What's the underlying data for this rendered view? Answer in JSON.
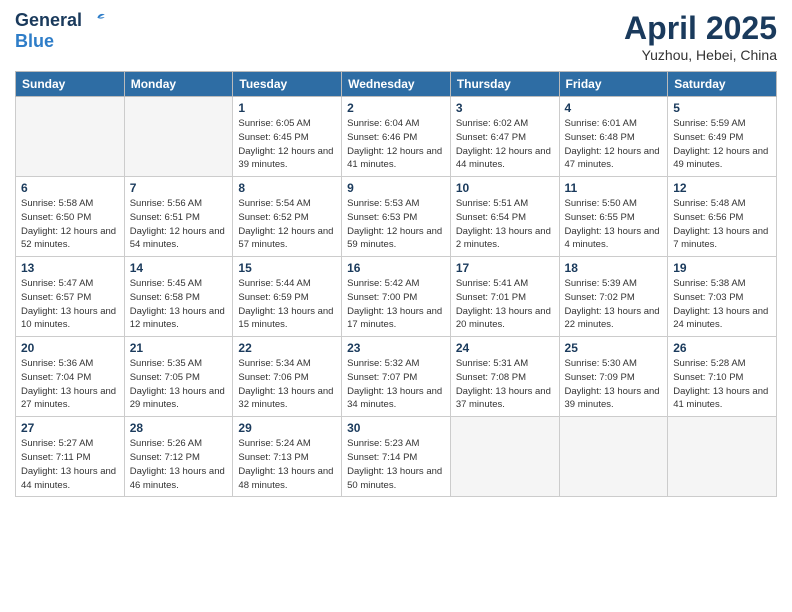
{
  "header": {
    "logo_general": "General",
    "logo_blue": "Blue",
    "month_title": "April 2025",
    "location": "Yuzhou, Hebei, China"
  },
  "weekdays": [
    "Sunday",
    "Monday",
    "Tuesday",
    "Wednesday",
    "Thursday",
    "Friday",
    "Saturday"
  ],
  "weeks": [
    [
      {
        "day": "",
        "empty": true
      },
      {
        "day": "",
        "empty": true
      },
      {
        "day": "1",
        "sunrise": "Sunrise: 6:05 AM",
        "sunset": "Sunset: 6:45 PM",
        "daylight": "Daylight: 12 hours and 39 minutes."
      },
      {
        "day": "2",
        "sunrise": "Sunrise: 6:04 AM",
        "sunset": "Sunset: 6:46 PM",
        "daylight": "Daylight: 12 hours and 41 minutes."
      },
      {
        "day": "3",
        "sunrise": "Sunrise: 6:02 AM",
        "sunset": "Sunset: 6:47 PM",
        "daylight": "Daylight: 12 hours and 44 minutes."
      },
      {
        "day": "4",
        "sunrise": "Sunrise: 6:01 AM",
        "sunset": "Sunset: 6:48 PM",
        "daylight": "Daylight: 12 hours and 47 minutes."
      },
      {
        "day": "5",
        "sunrise": "Sunrise: 5:59 AM",
        "sunset": "Sunset: 6:49 PM",
        "daylight": "Daylight: 12 hours and 49 minutes."
      }
    ],
    [
      {
        "day": "6",
        "sunrise": "Sunrise: 5:58 AM",
        "sunset": "Sunset: 6:50 PM",
        "daylight": "Daylight: 12 hours and 52 minutes."
      },
      {
        "day": "7",
        "sunrise": "Sunrise: 5:56 AM",
        "sunset": "Sunset: 6:51 PM",
        "daylight": "Daylight: 12 hours and 54 minutes."
      },
      {
        "day": "8",
        "sunrise": "Sunrise: 5:54 AM",
        "sunset": "Sunset: 6:52 PM",
        "daylight": "Daylight: 12 hours and 57 minutes."
      },
      {
        "day": "9",
        "sunrise": "Sunrise: 5:53 AM",
        "sunset": "Sunset: 6:53 PM",
        "daylight": "Daylight: 12 hours and 59 minutes."
      },
      {
        "day": "10",
        "sunrise": "Sunrise: 5:51 AM",
        "sunset": "Sunset: 6:54 PM",
        "daylight": "Daylight: 13 hours and 2 minutes."
      },
      {
        "day": "11",
        "sunrise": "Sunrise: 5:50 AM",
        "sunset": "Sunset: 6:55 PM",
        "daylight": "Daylight: 13 hours and 4 minutes."
      },
      {
        "day": "12",
        "sunrise": "Sunrise: 5:48 AM",
        "sunset": "Sunset: 6:56 PM",
        "daylight": "Daylight: 13 hours and 7 minutes."
      }
    ],
    [
      {
        "day": "13",
        "sunrise": "Sunrise: 5:47 AM",
        "sunset": "Sunset: 6:57 PM",
        "daylight": "Daylight: 13 hours and 10 minutes."
      },
      {
        "day": "14",
        "sunrise": "Sunrise: 5:45 AM",
        "sunset": "Sunset: 6:58 PM",
        "daylight": "Daylight: 13 hours and 12 minutes."
      },
      {
        "day": "15",
        "sunrise": "Sunrise: 5:44 AM",
        "sunset": "Sunset: 6:59 PM",
        "daylight": "Daylight: 13 hours and 15 minutes."
      },
      {
        "day": "16",
        "sunrise": "Sunrise: 5:42 AM",
        "sunset": "Sunset: 7:00 PM",
        "daylight": "Daylight: 13 hours and 17 minutes."
      },
      {
        "day": "17",
        "sunrise": "Sunrise: 5:41 AM",
        "sunset": "Sunset: 7:01 PM",
        "daylight": "Daylight: 13 hours and 20 minutes."
      },
      {
        "day": "18",
        "sunrise": "Sunrise: 5:39 AM",
        "sunset": "Sunset: 7:02 PM",
        "daylight": "Daylight: 13 hours and 22 minutes."
      },
      {
        "day": "19",
        "sunrise": "Sunrise: 5:38 AM",
        "sunset": "Sunset: 7:03 PM",
        "daylight": "Daylight: 13 hours and 24 minutes."
      }
    ],
    [
      {
        "day": "20",
        "sunrise": "Sunrise: 5:36 AM",
        "sunset": "Sunset: 7:04 PM",
        "daylight": "Daylight: 13 hours and 27 minutes."
      },
      {
        "day": "21",
        "sunrise": "Sunrise: 5:35 AM",
        "sunset": "Sunset: 7:05 PM",
        "daylight": "Daylight: 13 hours and 29 minutes."
      },
      {
        "day": "22",
        "sunrise": "Sunrise: 5:34 AM",
        "sunset": "Sunset: 7:06 PM",
        "daylight": "Daylight: 13 hours and 32 minutes."
      },
      {
        "day": "23",
        "sunrise": "Sunrise: 5:32 AM",
        "sunset": "Sunset: 7:07 PM",
        "daylight": "Daylight: 13 hours and 34 minutes."
      },
      {
        "day": "24",
        "sunrise": "Sunrise: 5:31 AM",
        "sunset": "Sunset: 7:08 PM",
        "daylight": "Daylight: 13 hours and 37 minutes."
      },
      {
        "day": "25",
        "sunrise": "Sunrise: 5:30 AM",
        "sunset": "Sunset: 7:09 PM",
        "daylight": "Daylight: 13 hours and 39 minutes."
      },
      {
        "day": "26",
        "sunrise": "Sunrise: 5:28 AM",
        "sunset": "Sunset: 7:10 PM",
        "daylight": "Daylight: 13 hours and 41 minutes."
      }
    ],
    [
      {
        "day": "27",
        "sunrise": "Sunrise: 5:27 AM",
        "sunset": "Sunset: 7:11 PM",
        "daylight": "Daylight: 13 hours and 44 minutes."
      },
      {
        "day": "28",
        "sunrise": "Sunrise: 5:26 AM",
        "sunset": "Sunset: 7:12 PM",
        "daylight": "Daylight: 13 hours and 46 minutes."
      },
      {
        "day": "29",
        "sunrise": "Sunrise: 5:24 AM",
        "sunset": "Sunset: 7:13 PM",
        "daylight": "Daylight: 13 hours and 48 minutes."
      },
      {
        "day": "30",
        "sunrise": "Sunrise: 5:23 AM",
        "sunset": "Sunset: 7:14 PM",
        "daylight": "Daylight: 13 hours and 50 minutes."
      },
      {
        "day": "",
        "empty": true
      },
      {
        "day": "",
        "empty": true
      },
      {
        "day": "",
        "empty": true
      }
    ]
  ]
}
